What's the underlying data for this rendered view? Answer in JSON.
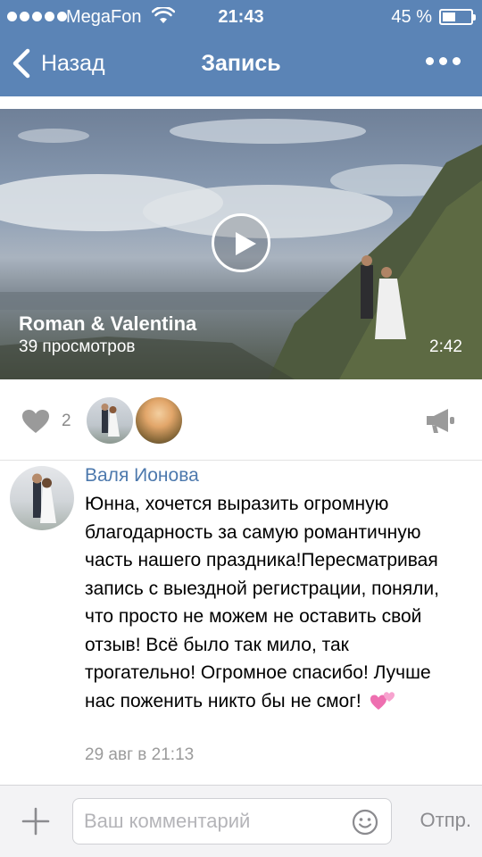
{
  "status_bar": {
    "carrier": "MegaFon",
    "time": "21:43",
    "battery_percent": "45 %",
    "battery_level": 0.45
  },
  "nav": {
    "back_label": "Назад",
    "title": "Запись"
  },
  "video": {
    "title": "Roman & Valentina",
    "views": "39 просмотров",
    "duration": "2:42"
  },
  "likes": {
    "count": "2"
  },
  "comment": {
    "author": "Валя Ионова",
    "text": "Юнна, хочется выразить огромную благодарность за самую романтичную часть нашего праздника!Пересматривая запись с выездной регистрации, поняли, что просто не можем не оставить свой отзыв! Всё было так мило, так трогательно! Огромное спасибо! Лучше нас поженить никто бы не смог!",
    "emoji": "two-hearts-icon",
    "date": "29 авг в 21:13"
  },
  "input_bar": {
    "placeholder": "Ваш комментарий",
    "value": "",
    "send_label": "Отпр."
  },
  "colors": {
    "header": "#5b84b6",
    "author_link": "#4d79ad",
    "muted": "#9b9b9b"
  }
}
